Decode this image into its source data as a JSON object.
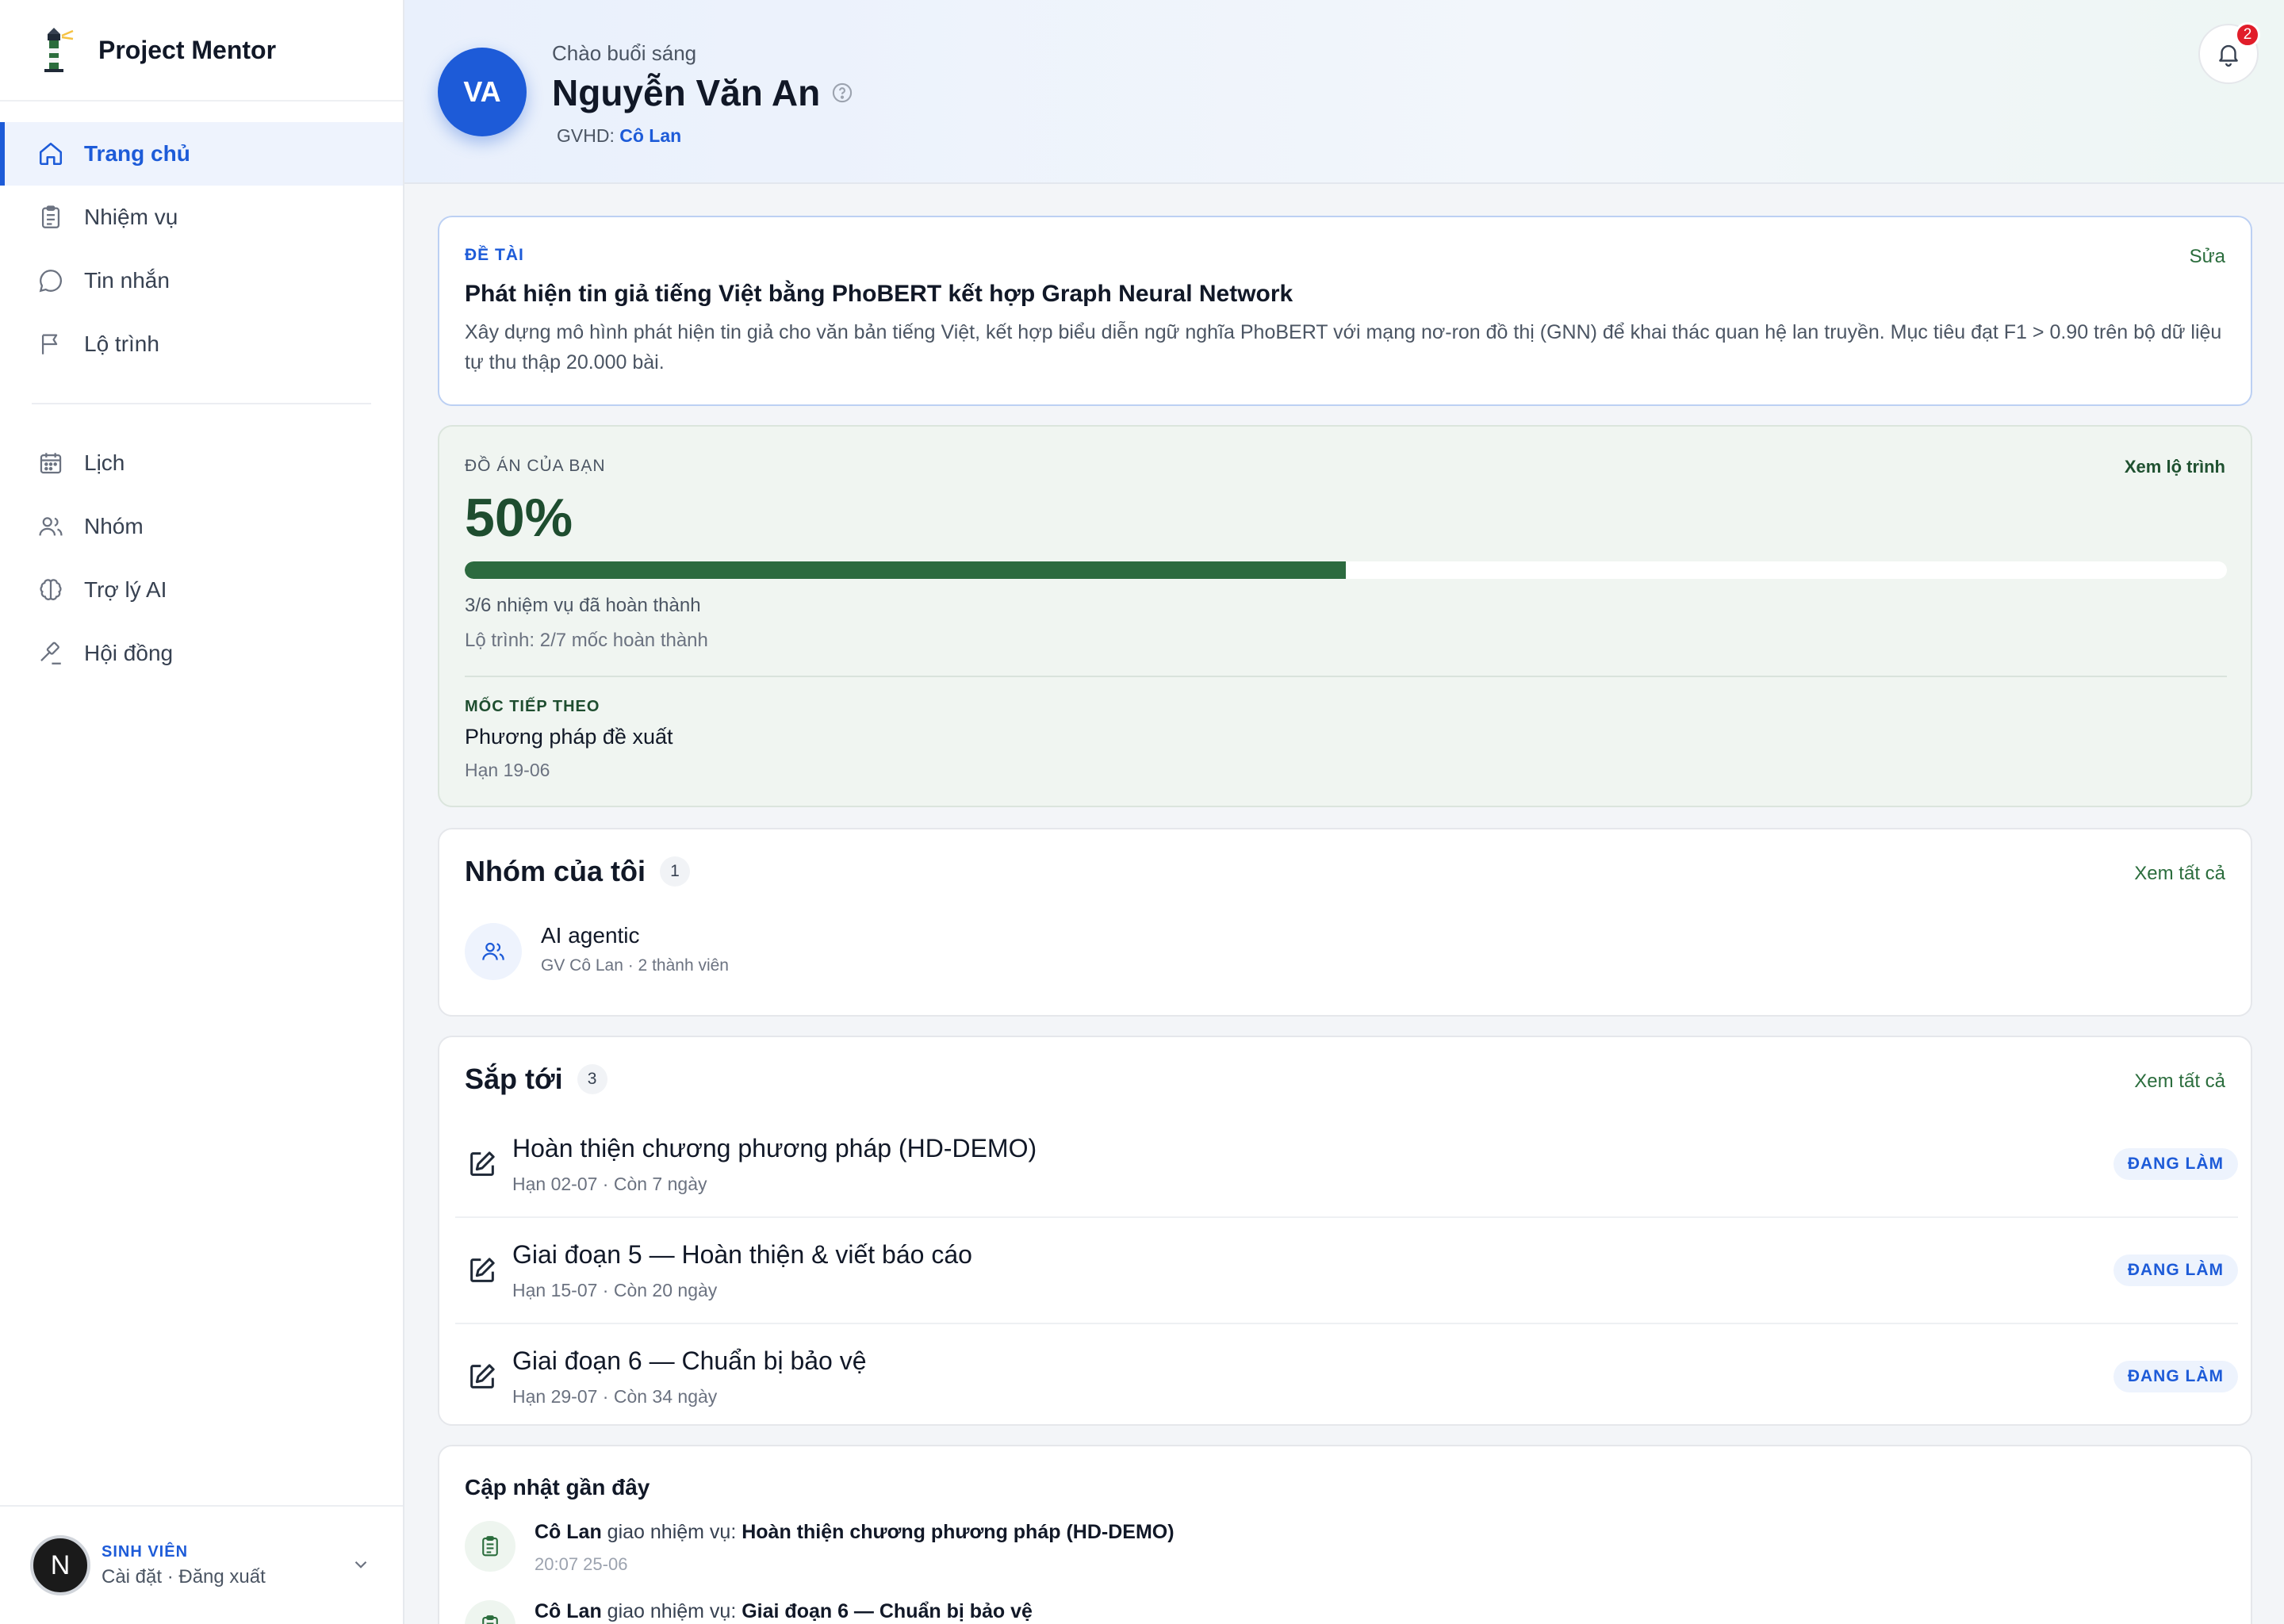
{
  "brand": {
    "name": "Project Mentor"
  },
  "nav": {
    "primary": [
      {
        "label": "Trang chủ",
        "icon": "home-icon",
        "active": true
      },
      {
        "label": "Nhiệm vụ",
        "icon": "clipboard-icon"
      },
      {
        "label": "Tin nhắn",
        "icon": "chat-bubble-icon"
      },
      {
        "label": "Lộ trình",
        "icon": "flag-icon"
      }
    ],
    "secondary": [
      {
        "label": "Lịch",
        "icon": "calendar-icon"
      },
      {
        "label": "Nhóm",
        "icon": "users-icon"
      },
      {
        "label": "Trợ lý AI",
        "icon": "brain-icon"
      },
      {
        "label": "Hội đồng",
        "icon": "gavel-icon"
      }
    ]
  },
  "user": {
    "initial": "N",
    "role": "SINH VIÊN",
    "links": "Cài đặt · Đăng xuất"
  },
  "header": {
    "initials": "VA",
    "greeting": "Chào buổi sáng",
    "name": "Nguyễn Văn An",
    "advisor_label": "GVHD:",
    "advisor": "Cô Lan",
    "notifications": "2"
  },
  "topic": {
    "tag": "ĐỀ TÀI",
    "edit": "Sửa",
    "title": "Phát hiện tin giả tiếng Việt bằng PhoBERT kết hợp Graph Neural Network",
    "description": "Xây dựng mô hình phát hiện tin giả cho văn bản tiếng Việt, kết hợp biểu diễn ngữ nghĩa PhoBERT với mạng nơ-ron đồ thị (GNN) để khai thác quan hệ lan truyền. Mục tiêu đạt F1 > 0.90 trên bộ dữ liệu tự thu thập 20.000 bài."
  },
  "progress": {
    "tag": "ĐỒ ÁN CỦA BẠN",
    "link": "Xem lộ trình",
    "percent_label": "50%",
    "percent": 50,
    "tasks_done": "3/6 nhiệm vụ đã hoàn thành",
    "milestones_done": "Lộ trình: 2/7 mốc hoàn thành",
    "next_tag": "MỐC TIẾP THEO",
    "next_title": "Phương pháp đề xuất",
    "next_due": "Hạn 19-06"
  },
  "groups": {
    "title": "Nhóm của tôi",
    "count": "1",
    "see_all": "Xem tất cả",
    "items": [
      {
        "name": "AI agentic",
        "meta": "GV Cô Lan · 2 thành viên"
      }
    ]
  },
  "upcoming": {
    "title": "Sắp tới",
    "count": "3",
    "see_all": "Xem tất cả",
    "items": [
      {
        "title": "Hoàn thiện chương phương pháp (HD-DEMO)",
        "meta": "Hạn 02-07 · Còn 7 ngày",
        "status": "ĐANG LÀM"
      },
      {
        "title": "Giai đoạn 5 — Hoàn thiện & viết báo cáo",
        "meta": "Hạn 15-07 · Còn 20 ngày",
        "status": "ĐANG LÀM"
      },
      {
        "title": "Giai đoạn 6 — Chuẩn bị bảo vệ",
        "meta": "Hạn 29-07 · Còn 34 ngày",
        "status": "ĐANG LÀM"
      }
    ]
  },
  "updates": {
    "title": "Cập nhật gần đây",
    "items": [
      {
        "actor": "Cô Lan",
        "action": "giao nhiệm vụ:",
        "target": "Hoàn thiện chương phương pháp (HD-DEMO)",
        "time": "20:07 25-06"
      },
      {
        "actor": "Cô Lan",
        "action": "giao nhiệm vụ:",
        "target": "Giai đoạn 6 — Chuẩn bị bảo vệ",
        "time": ""
      }
    ]
  },
  "colors": {
    "accent": "#1d5bd8",
    "progress": "#2c6a3f",
    "badge": "#e11d2a"
  }
}
